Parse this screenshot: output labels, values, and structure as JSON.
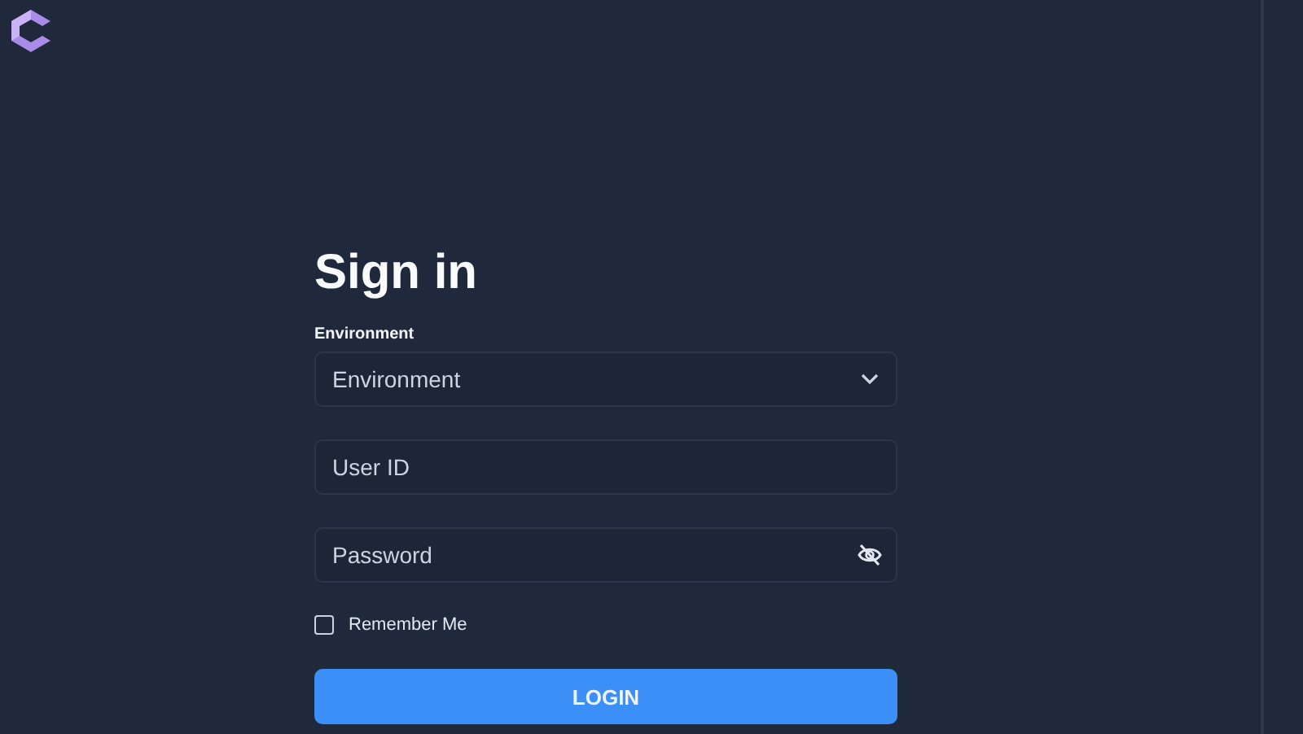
{
  "heading": "Sign in",
  "environment": {
    "label": "Environment",
    "placeholder": "Environment"
  },
  "user_id": {
    "placeholder": "User ID"
  },
  "password": {
    "placeholder": "Password"
  },
  "remember_me": {
    "label": "Remember Me",
    "checked": false
  },
  "login_button": {
    "label": "LOGIN"
  }
}
